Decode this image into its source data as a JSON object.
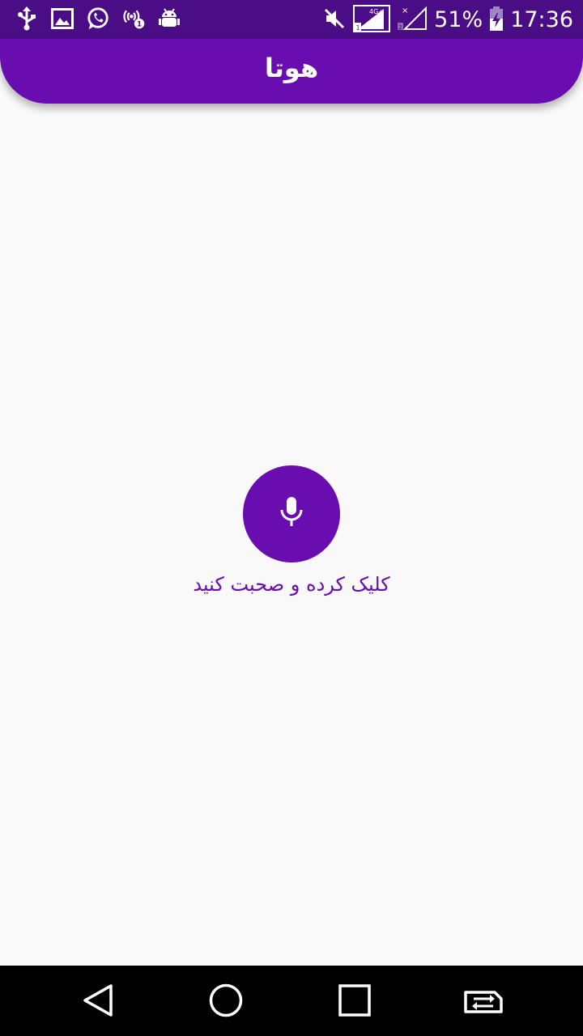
{
  "status_bar": {
    "battery_percent": "51%",
    "time": "17:36",
    "left_icons": [
      "usb-icon",
      "image-icon",
      "whatsapp-icon",
      "hotspot-icon",
      "android-debug-icon"
    ],
    "right_icons": [
      "mute-icon",
      "signal-sim1-icon",
      "signal-sim2-icon",
      "battery-charging-icon"
    ],
    "network_label": "4G+"
  },
  "app_bar": {
    "title": "هوتا"
  },
  "main": {
    "mic_icon": "microphone-icon",
    "hint": "کلیک کرده و صحبت کنید"
  },
  "nav_bar": {
    "icons": [
      "back-icon",
      "home-icon",
      "recents-icon",
      "sim-switch-icon"
    ]
  },
  "colors": {
    "status_bar": "#4a0d86",
    "accent": "#6a0db0",
    "background": "#f9f9f9",
    "nav_bar": "#000000"
  }
}
